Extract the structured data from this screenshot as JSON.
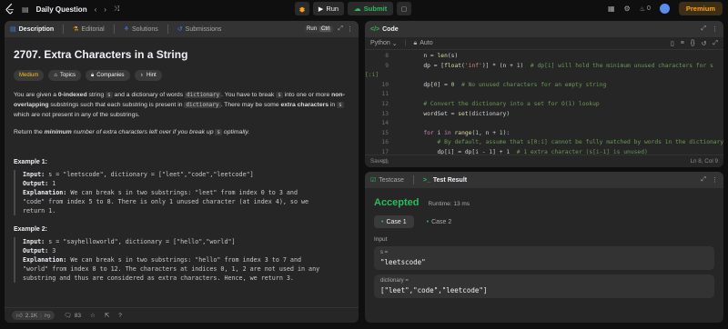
{
  "topbar": {
    "title": "Daily Question",
    "run_label": "Run",
    "submit_label": "Submit",
    "streak_count": "0",
    "premium_label": "Premium",
    "colors": {
      "brand": "#ffa116",
      "submit": "#2cbb5d"
    }
  },
  "description": {
    "tabs": [
      {
        "label": "Description"
      },
      {
        "label": "Editorial"
      },
      {
        "label": "Solutions"
      },
      {
        "label": "Submissions"
      }
    ],
    "run_hint": "Run",
    "run_hint_key": "Ctrl",
    "title": "2707. Extra Characters in a String",
    "difficulty": "Medium",
    "chips": [
      "Topics",
      "Companies",
      "Hint"
    ],
    "para1": {
      "t1": "You are given a ",
      "b1": "0-indexed",
      "t2": " string ",
      "c1": "s",
      "t3": " and a dictionary of words ",
      "c2": "dictionary",
      "t4": ". You have to break ",
      "c3": "s",
      "t5": " into one or more ",
      "b2": "non-overlapping",
      "t6": " substrings such that each substring is present in ",
      "c4": "dictionary",
      "t7": ". There may be some ",
      "b3": "extra characters",
      "t8": " in ",
      "c5": "s",
      "t9": " which are not present in any of the substrings."
    },
    "para2": {
      "t1": "Return the ",
      "b1": "minimum",
      "t2": " number of extra characters left over if you break up ",
      "c1": "s",
      "t3": " optimally."
    },
    "example1": {
      "title": "Example 1:",
      "input_key": "Input:",
      "input_val": " s = \"leetscode\", dictionary = [\"leet\",\"code\",\"leetcode\"]",
      "output_key": "Output:",
      "output_val": " 1",
      "expl_key": "Explanation:",
      "expl_lines": [
        " We can break s in two substrings: \"leet\" from index 0 to 3 and",
        "\"code\" from index 5 to 8. There is only 1 unused character (at index 4), so we",
        "return 1."
      ]
    },
    "example2": {
      "title": "Example 2:",
      "input_key": "Input:",
      "input_val": " s = \"sayhelloworld\", dictionary = [\"hello\",\"world\"]",
      "output_key": "Output:",
      "output_val": " 3",
      "expl_key": "Explanation:",
      "expl_lines": [
        " We can break s in two substrings: \"hello\" from index 3 to 7 and",
        "\"world\" from index 8 to 12. The characters at indices 0, 1, 2 are not used in any",
        "substring and thus are considered as extra characters. Hence, we return 3."
      ]
    },
    "footer": {
      "likes": "2.1K",
      "comments": "83"
    }
  },
  "code": {
    "title": "Code",
    "language": "Python",
    "auto_label": "Auto",
    "status": "Saved",
    "cursor": "Ln 8, Col 9",
    "lines": [
      {
        "n": "8",
        "text": "        n = len(s)"
      },
      {
        "n": "9",
        "text": "        dp = [float('inf')] * (n + 1)  # dp[i] will hold the minimum unused characters for s"
      },
      {
        "n": "",
        "text": "[:i]"
      },
      {
        "n": "10",
        "text": "        dp[0] = 0  # No unused characters for an empty string"
      },
      {
        "n": "11",
        "text": ""
      },
      {
        "n": "12",
        "text": "        # Convert the dictionary into a set for O(1) lookup"
      },
      {
        "n": "13",
        "text": "        wordSet = set(dictionary)"
      },
      {
        "n": "14",
        "text": ""
      },
      {
        "n": "15",
        "text": "        for i in range(1, n + 1):"
      },
      {
        "n": "16",
        "text": "            # By default, assume that s[0:i] cannot be fully matched by words in the dictionary"
      },
      {
        "n": "17",
        "text": "            dp[i] = dp[i - 1] + 1  # 1 extra character (s[i-1] is unused)"
      },
      {
        "n": "18",
        "text": ""
      }
    ]
  },
  "result": {
    "tabs": [
      {
        "label": "Testcase"
      },
      {
        "label": "Test Result"
      }
    ],
    "verdict": "Accepted",
    "runtime": "Runtime: 13 ms",
    "cases": [
      {
        "label": "Case 1"
      },
      {
        "label": "Case 2"
      }
    ],
    "input_label": "Input",
    "params": [
      {
        "name": "s =",
        "value": "\"leetscode\""
      },
      {
        "name": "dictionary =",
        "value": "[\"leet\",\"code\",\"leetcode\"]"
      }
    ]
  }
}
